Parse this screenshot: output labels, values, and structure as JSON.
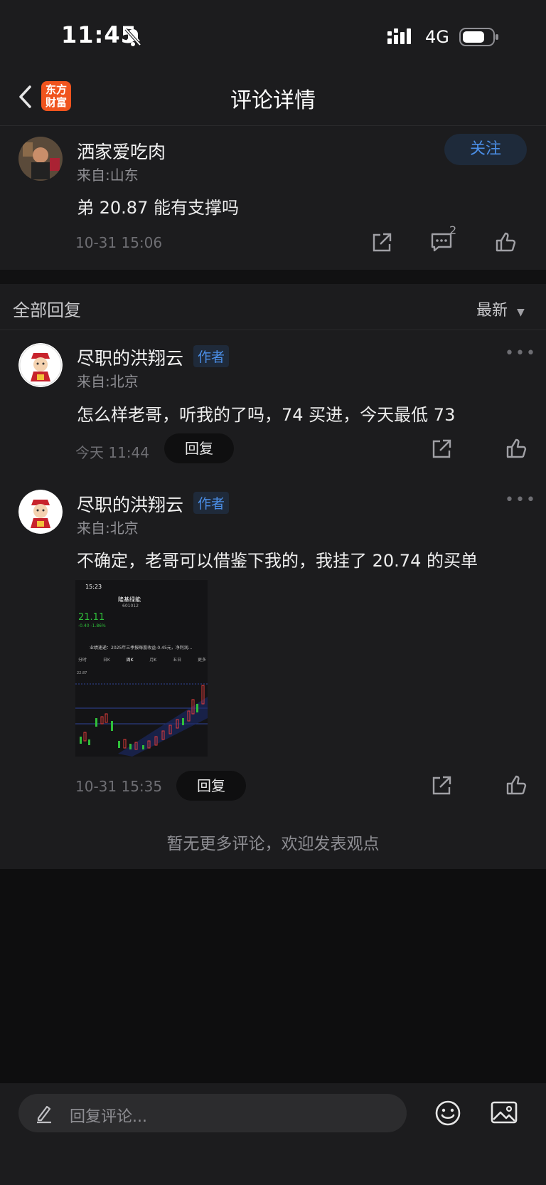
{
  "status_bar": {
    "time": "11:45",
    "network": "4G"
  },
  "nav": {
    "title": "评论详情",
    "logo_line1": "东方",
    "logo_line2": "财富"
  },
  "post": {
    "author": "洒家爱吃肉",
    "from": "来自:山东",
    "content": "弟 20.87 能有支撑吗",
    "time": "10-31 15:06",
    "comment_count": "2",
    "follow_label": "关注"
  },
  "replies_header": {
    "title": "全部回复",
    "sort_label": "最新"
  },
  "replies": [
    {
      "author": "尽职的洪翔云",
      "tag": "作者",
      "from": "来自:北京",
      "content": "怎么样老哥，听我的了吗，74 买进，今天最低 73",
      "time": "今天 11:44",
      "reply_label": "回复"
    },
    {
      "author": "尽职的洪翔云",
      "tag": "作者",
      "from": "来自:北京",
      "content": "不确定，老哥可以借鉴下我的，我挂了 20.74 的买单",
      "time": "10-31 15:35",
      "reply_label": "回复"
    }
  ],
  "screenshot_thumb": {
    "time": "15:23",
    "stock_name": "隆基绿能",
    "stock_code": "601012",
    "price": "21.11",
    "change": "-0.40 -1.86%",
    "notice": "业绩速递：2025年三季报每股收益-0.45元，净利润...",
    "tabs": [
      "分时",
      "日K",
      "周K",
      "月K",
      "五日",
      "更多"
    ],
    "high_label": "22.87"
  },
  "footer_text": "暂无更多评论，欢迎发表观点",
  "bottom_bar": {
    "placeholder": "回复评论..."
  },
  "colors": {
    "accent": "#4b8ee6",
    "brand": "#f0541e",
    "up": "#e23b3b",
    "down": "#2fbf3a"
  }
}
